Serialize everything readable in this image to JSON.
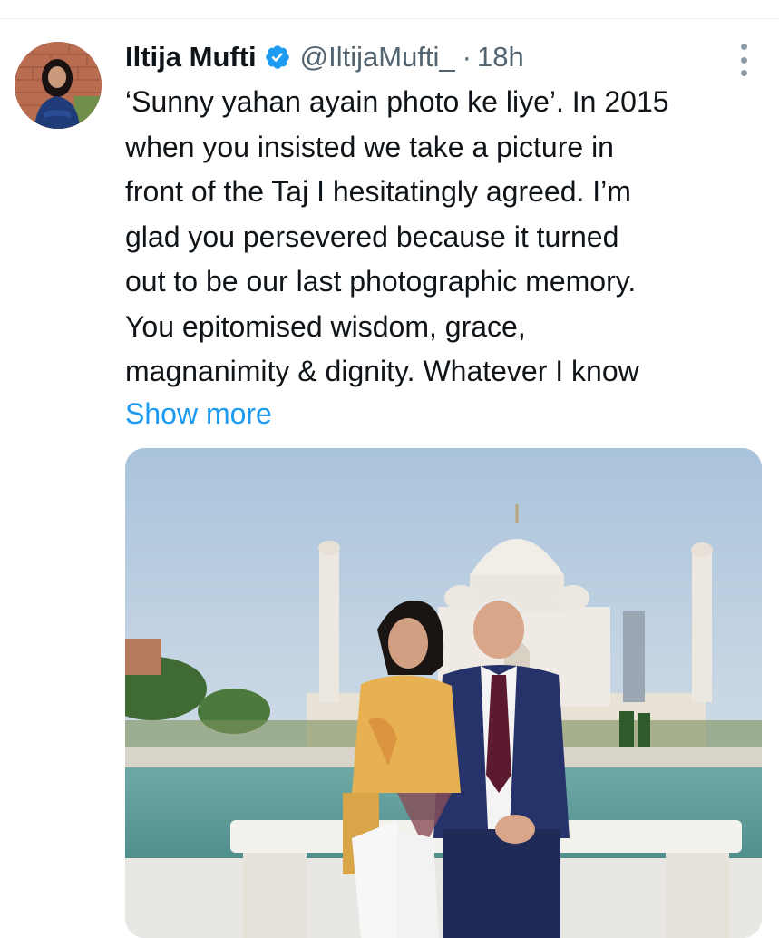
{
  "tweet": {
    "author": {
      "display_name": "Iltija Mufti",
      "handle": "@IltijaMufti_",
      "verified": true
    },
    "separator": "·",
    "timestamp": "18h",
    "text_lines": [
      "‘Sunny yahan ayain photo ke liye’. In 2015",
      "when you insisted we take a picture in",
      "front of the Taj I hesitatingly agreed. I’m",
      "glad you persevered because it turned",
      "out to be our last photographic memory.",
      "You epitomised wisdom, grace,",
      "magnanimity & dignity. Whatever I know"
    ],
    "show_more_label": "Show more"
  },
  "colors": {
    "text_primary": "#0f1419",
    "text_secondary": "#536471",
    "link": "#1d9bf0",
    "verified_badge": "#1d9bf0"
  },
  "icons": {
    "verified": "verified-badge-icon",
    "more": "more-options-icon"
  }
}
